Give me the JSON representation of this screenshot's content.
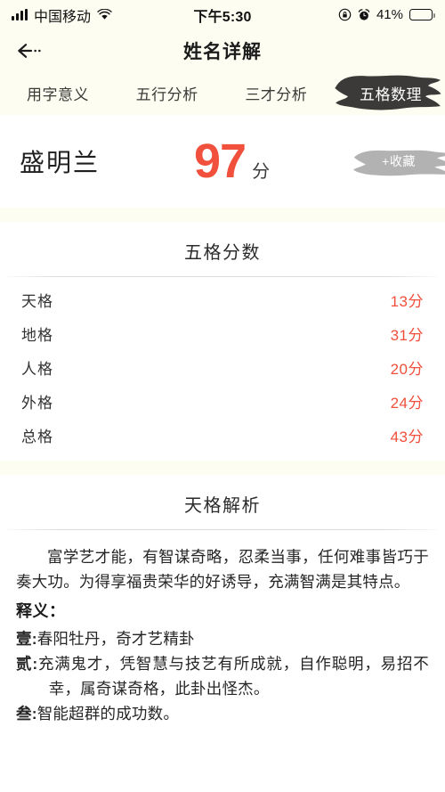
{
  "status_bar": {
    "carrier": "中国移动",
    "time": "下午5:30",
    "battery_percent": "41%",
    "battery_level": 41,
    "icons": [
      "signal-bars-icon",
      "wifi-icon",
      "rotation-lock-icon",
      "alarm-clock-icon",
      "battery-icon"
    ]
  },
  "header": {
    "title": "姓名详解",
    "back_label": "←"
  },
  "tabs": [
    {
      "label": "用字意义",
      "active": false
    },
    {
      "label": "五行分析",
      "active": false
    },
    {
      "label": "三才分析",
      "active": false
    },
    {
      "label": "五格数理",
      "active": true
    }
  ],
  "name_card": {
    "name": "盛明兰",
    "score": "97",
    "score_unit": "分",
    "favorite_label": "+收藏",
    "score_color": "#f1503c",
    "favorite_color": "#b2b2b2"
  },
  "score_section": {
    "title": "五格分数",
    "rows": [
      {
        "label": "天格",
        "value": "13分"
      },
      {
        "label": "地格",
        "value": "31分"
      },
      {
        "label": "人格",
        "value": "20分"
      },
      {
        "label": "外格",
        "value": "24分"
      },
      {
        "label": "总格",
        "value": "43分"
      }
    ]
  },
  "analysis_section": {
    "title": "天格解析",
    "paragraph": "富学艺才能，有智谋奇略，忍柔当事，任何难事皆巧于奏大功。为得享福贵荣华的好诱导，充满智满是其特点。",
    "meaning_heading": "释义：",
    "meanings": [
      {
        "index": "壹:",
        "text": "春阳牡丹，奇才艺精卦"
      },
      {
        "index": "贰:",
        "text": "充满鬼才，凭智慧与技艺有所成就，自作聪明，易招不幸，属奇谋奇格，此卦出怪杰。"
      },
      {
        "index": "叁:",
        "text": "智能超群的成功数。"
      }
    ]
  }
}
